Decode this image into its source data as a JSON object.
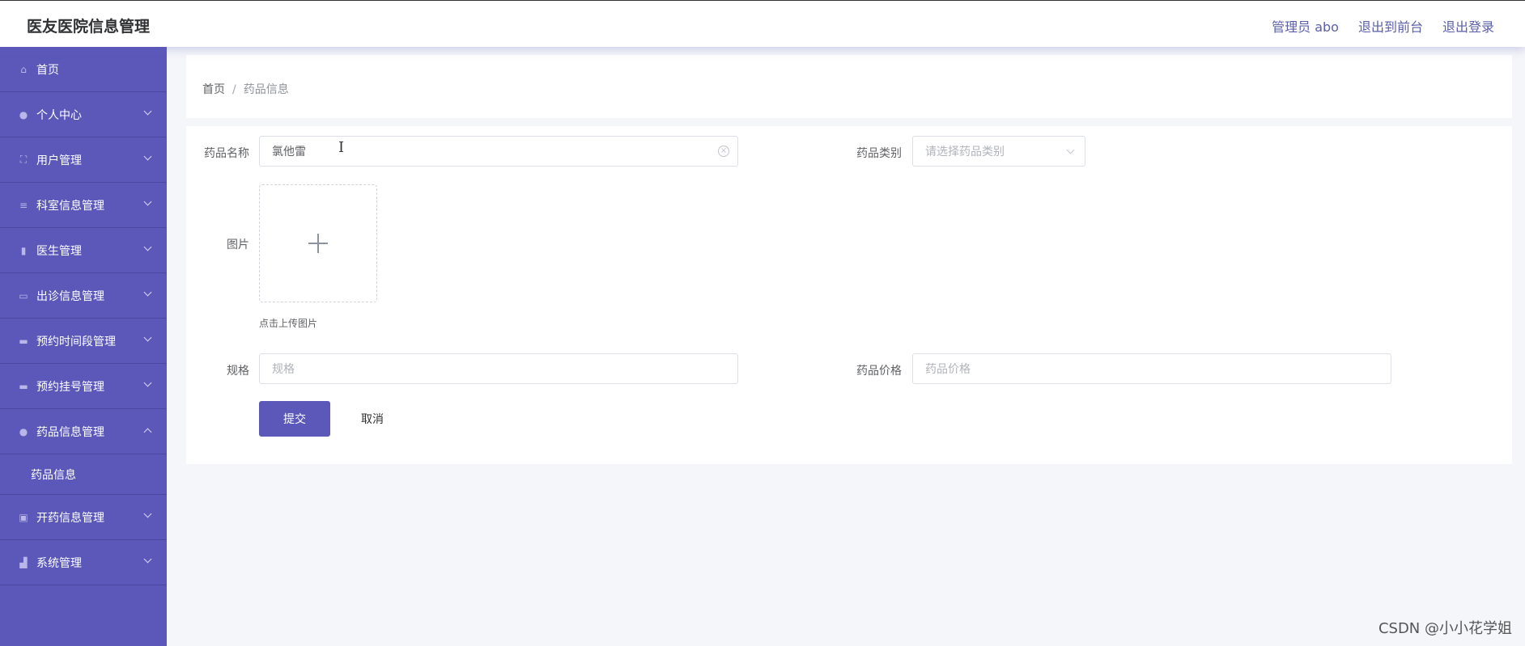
{
  "header": {
    "title": "医友医院信息管理",
    "admin_label": "管理员 abo",
    "back_front": "退出到前台",
    "logout": "退出登录"
  },
  "sidebar": {
    "items": [
      {
        "label": "首页",
        "icon": "home-icon"
      },
      {
        "label": "个人中心",
        "icon": "user-icon"
      },
      {
        "label": "用户管理",
        "icon": "frame-icon"
      },
      {
        "label": "科室信息管理",
        "icon": "list-icon"
      },
      {
        "label": "医生管理",
        "icon": "chart-icon"
      },
      {
        "label": "出诊信息管理",
        "icon": "message-icon"
      },
      {
        "label": "预约时间段管理",
        "icon": "briefcase-icon"
      },
      {
        "label": "预约挂号管理",
        "icon": "chat-icon"
      },
      {
        "label": "药品信息管理",
        "icon": "user-icon"
      },
      {
        "label": "开药信息管理",
        "icon": "clipboard-icon"
      },
      {
        "label": "系统管理",
        "icon": "thumb-icon"
      }
    ],
    "sub_item": "药品信息"
  },
  "breadcrumb": {
    "home": "首页",
    "separator": "/",
    "current": "药品信息"
  },
  "form": {
    "name_label": "药品名称",
    "name_value": "氯他雷",
    "category_label": "药品类别",
    "category_placeholder": "请选择药品类别",
    "image_label": "图片",
    "upload_tip": "点击上传图片",
    "spec_label": "规格",
    "spec_placeholder": "规格",
    "price_label": "药品价格",
    "price_placeholder": "药品价格",
    "submit": "提交",
    "cancel": "取消"
  },
  "watermark": "CSDN @小小花学姐",
  "colors": {
    "sidebar": "#5b58b9",
    "accent": "#5b58b9",
    "header_link": "#5a5fa8"
  }
}
